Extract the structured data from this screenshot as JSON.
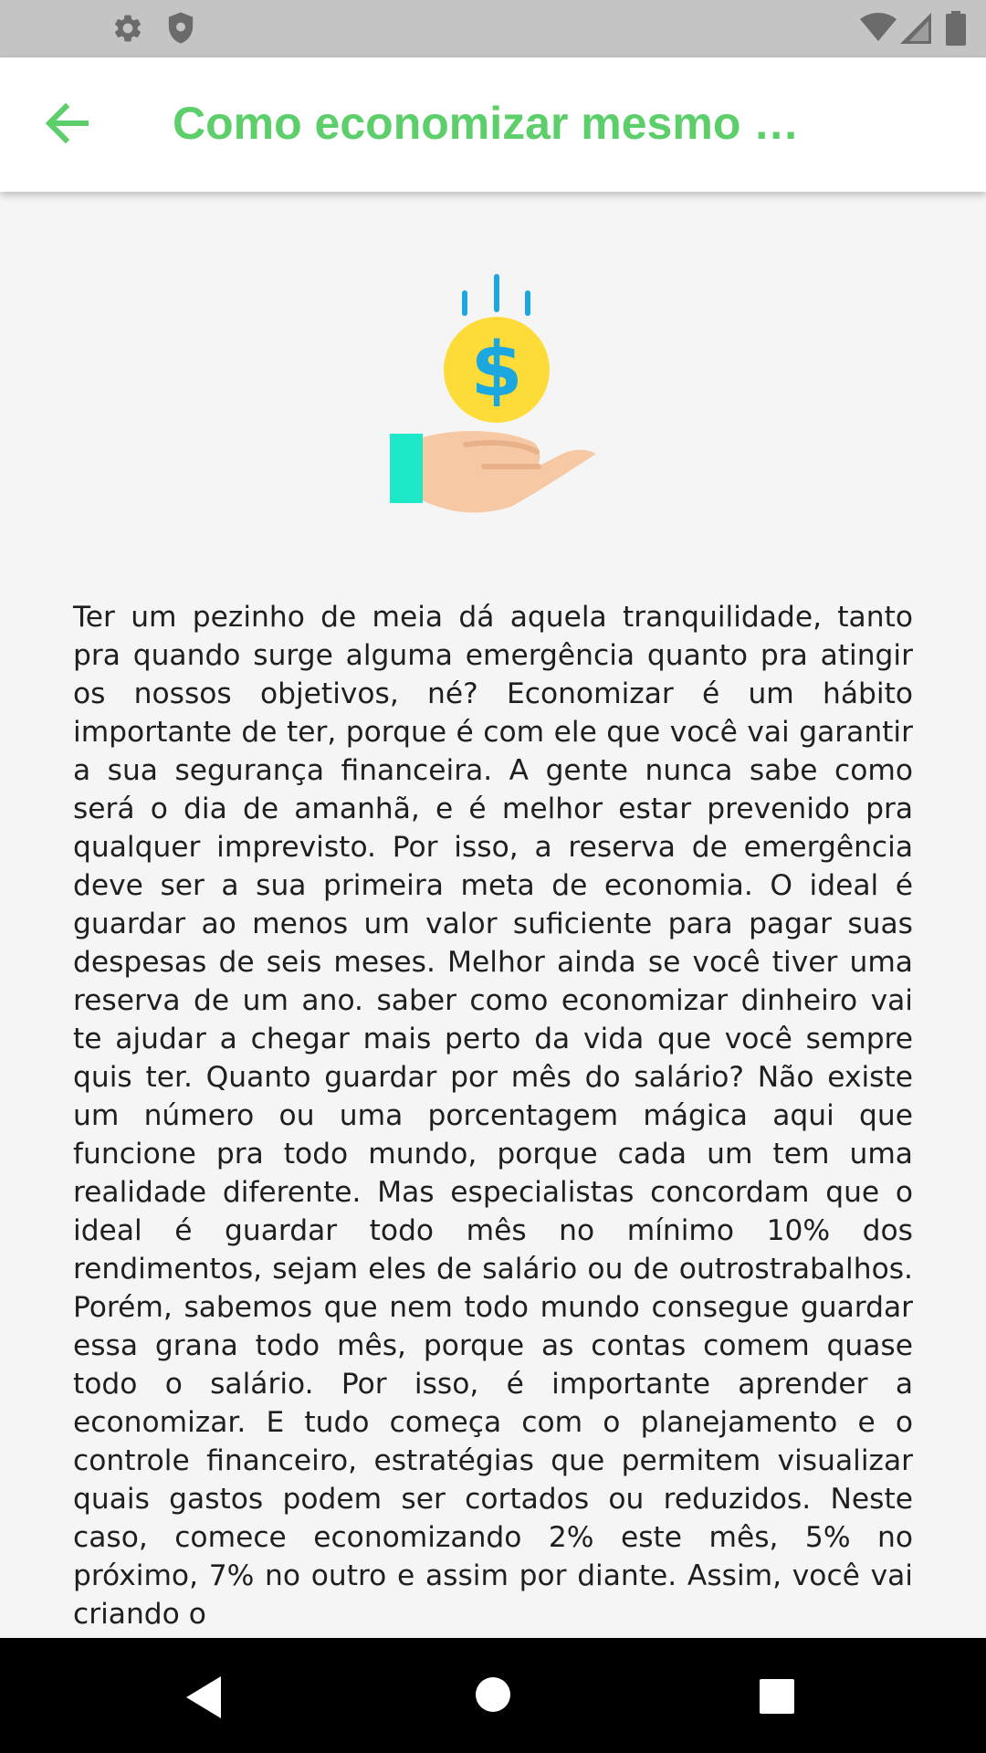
{
  "status_bar": {
    "left_icons": [
      "gear-icon",
      "shield-icon"
    ],
    "right_icons": [
      "wifi-icon",
      "cellular-signal-icon",
      "battery-icon"
    ]
  },
  "app_bar": {
    "back_icon": "arrow-back-icon",
    "title": "Como economizar mesmo …"
  },
  "illustration": {
    "icon": "hand-holding-coin-icon",
    "symbol": "$"
  },
  "article": {
    "text": "Ter um pezinho de meia dá aquela tranquilidade, tanto pra quando surge alguma emergência quanto pra atingir os nossos objetivos, né? Economizar é um hábito importante de ter, porque é com ele que você vai garantir a sua segurança financeira. A gente nunca sabe como será o dia de amanhã, e é melhor estar prevenido pra qualquer imprevisto. Por isso, a reserva de emergência deve ser a sua primeira meta de economia. O ideal é guardar ao menos um valor suficiente para pagar suas despesas de seis meses. Melhor ainda se você tiver uma reserva de um ano.  saber como economizar dinheiro vai te ajudar a chegar mais perto da vida que você sempre quis ter. Quanto guardar por mês do salário? Não existe um número ou uma porcentagem mágica aqui que funcione pra todo mundo, porque cada um tem uma realidade diferente. Mas especialistas concordam que o ideal é guardar todo mês no mínimo 10% dos rendimentos, sejam eles de salário ou de outrostrabalhos. Porém, sabemos que nem todo mundo consegue guardar essa grana todo mês, porque as contas comem quase todo o salário. Por isso, é importante aprender a economizar. E tudo começa com o planejamento e o controle financeiro, estratégias que permitem visualizar quais gastos podem ser cortados ou reduzidos. Neste caso, comece economizando 2% este mês, 5% no próximo, 7% no outro e assim por diante. Assim, você vai criando o"
  },
  "nav_bar": {
    "icons": [
      "nav-back-icon",
      "nav-home-icon",
      "nav-recents-icon"
    ]
  },
  "colors": {
    "accent": "#5cce6a",
    "status_bar": "#c4c4c4",
    "coin": "#fddc3a",
    "dollar": "#1ba8e0",
    "hand": "#f7c8a4",
    "cuff": "#1de9c9"
  }
}
